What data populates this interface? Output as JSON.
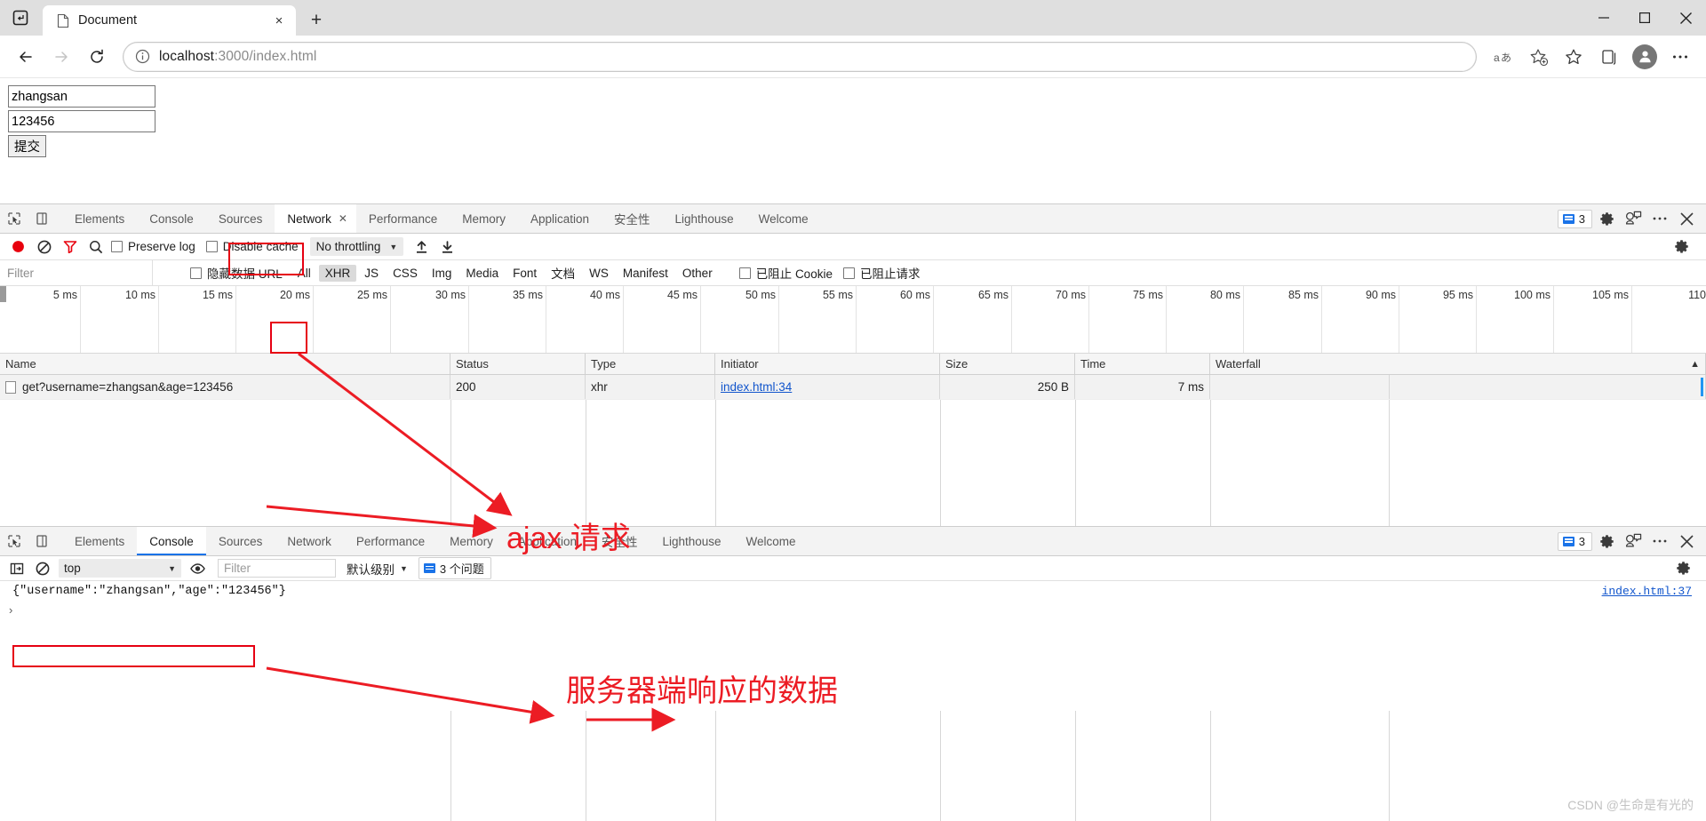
{
  "browser": {
    "tab": {
      "title": "Document",
      "close_label": "×"
    },
    "new_tab_label": "+",
    "window_controls": {
      "minimize": "─",
      "maximize": "☐",
      "close": "✕"
    },
    "nav": {
      "back": "back-arrow",
      "forward": "forward-arrow",
      "reload": "reload"
    },
    "url": {
      "prefix": "localhost",
      "suffix": ":3000/index.html",
      "full": "localhost:3000/index.html"
    },
    "toolbar_icons": [
      "read-aloud",
      "add-favorite",
      "favorites",
      "collections",
      "profile",
      "settings-more"
    ]
  },
  "page": {
    "username_value": "zhangsan",
    "username_placeholder": "",
    "password_value": "123456",
    "password_placeholder": "",
    "submit_label": "提交"
  },
  "devtools_network": {
    "tabs": [
      "Elements",
      "Console",
      "Sources",
      "Network",
      "Performance",
      "Memory",
      "Application",
      "安全性",
      "Lighthouse",
      "Welcome"
    ],
    "active_tab": "Network",
    "active_tab_close": "✕",
    "issues_count": "3",
    "right_icons": [
      "issues",
      "settings-gear",
      "customize",
      "more-options",
      "close-devtools"
    ],
    "toolbar": {
      "record_label": "record",
      "clear_label": "clear",
      "filter_label": "filter",
      "search_label": "search",
      "preserve_log": "Preserve log",
      "disable_cache": "Disable cache",
      "throttling": "No throttling",
      "throttling_caret": "▼",
      "import_label": "import-har",
      "export_label": "export-har"
    },
    "filterbar": {
      "filter_placeholder": "Filter",
      "hide_data_urls": "隐藏数据 URL",
      "types": [
        "All",
        "XHR",
        "JS",
        "CSS",
        "Img",
        "Media",
        "Font",
        "文档",
        "WS",
        "Manifest",
        "Other"
      ],
      "selected_type": "XHR",
      "blocked_cookies": "已阻止 Cookie",
      "blocked_requests": "已阻止请求"
    },
    "timeline": {
      "ticks": [
        "5 ms",
        "10 ms",
        "15 ms",
        "20 ms",
        "25 ms",
        "30 ms",
        "35 ms",
        "40 ms",
        "45 ms",
        "50 ms",
        "55 ms",
        "60 ms",
        "65 ms",
        "70 ms",
        "75 ms",
        "80 ms",
        "85 ms",
        "90 ms",
        "95 ms",
        "100 ms",
        "105 ms",
        "110"
      ]
    },
    "table": {
      "columns": [
        "Name",
        "Status",
        "Type",
        "Initiator",
        "Size",
        "Time",
        "Waterfall"
      ],
      "sort_indicator": "▲",
      "rows": [
        {
          "name": "get?username=zhangsan&age=123456",
          "status": "200",
          "type": "xhr",
          "initiator": "index.html:34",
          "size": "250 B",
          "time": "7 ms"
        }
      ]
    }
  },
  "devtools_console": {
    "tabs": [
      "Elements",
      "Console",
      "Sources",
      "Network",
      "Performance",
      "Memory",
      "Application",
      "安全性",
      "Lighthouse",
      "Welcome"
    ],
    "active_tab": "Console",
    "issues_count": "3",
    "toolbar": {
      "sidebar_label": "show-console-sidebar",
      "clear_label": "clear-console",
      "context": "top",
      "context_caret": "▼",
      "eye_label": "live-expression",
      "filter_placeholder": "Filter",
      "level": "默认级别",
      "level_caret": "▼",
      "issues_pill": "3 个问题"
    },
    "messages": [
      {
        "text": "{\"username\":\"zhangsan\",\"age\":\"123456\"}",
        "source": "index.html:37"
      }
    ],
    "prompt": "›"
  },
  "annotations": {
    "ajax_label": "ajax 请求",
    "response_label": "服务器端响应的数据",
    "accent_color": "#ec1c24",
    "boxes": [
      "network-tab-box",
      "xhr-filter-box",
      "console-output-box"
    ]
  },
  "watermark": "CSDN @生命是有光的"
}
